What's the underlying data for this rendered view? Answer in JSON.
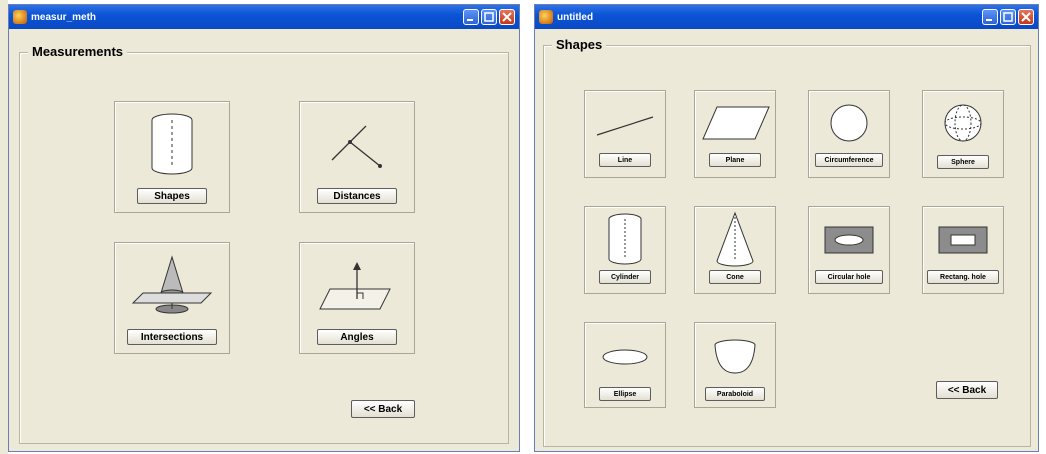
{
  "left_window": {
    "title": "measur_meth",
    "panel_title": "Measurements",
    "tiles": [
      {
        "label": "Shapes",
        "icon": "cylinder-icon"
      },
      {
        "label": "Distances",
        "icon": "distance-lines-icon"
      },
      {
        "label": "Intersections",
        "icon": "cone-plane-intersection-icon"
      },
      {
        "label": "Angles",
        "icon": "angle-plane-icon"
      }
    ],
    "back_label": "<< Back"
  },
  "right_window": {
    "title": "untitled",
    "panel_title": "Shapes",
    "tiles": [
      {
        "label": "Line",
        "icon": "line-icon"
      },
      {
        "label": "Plane",
        "icon": "plane-icon"
      },
      {
        "label": "Circumference",
        "icon": "circle-icon"
      },
      {
        "label": "Sphere",
        "icon": "sphere-icon"
      },
      {
        "label": "Cylinder",
        "icon": "cylinder-icon"
      },
      {
        "label": "Cone",
        "icon": "cone-icon"
      },
      {
        "label": "Circular hole",
        "icon": "circular-hole-icon"
      },
      {
        "label": "Rectang. hole",
        "icon": "rectangular-hole-icon"
      },
      {
        "label": "Ellipse",
        "icon": "ellipse-icon"
      },
      {
        "label": "Paraboloid",
        "icon": "paraboloid-icon"
      }
    ],
    "back_label": "<< Back"
  },
  "colors": {
    "titlebar": "#0b55d6",
    "window_bg": "#ece9d8",
    "close_button": "#c3391a"
  }
}
